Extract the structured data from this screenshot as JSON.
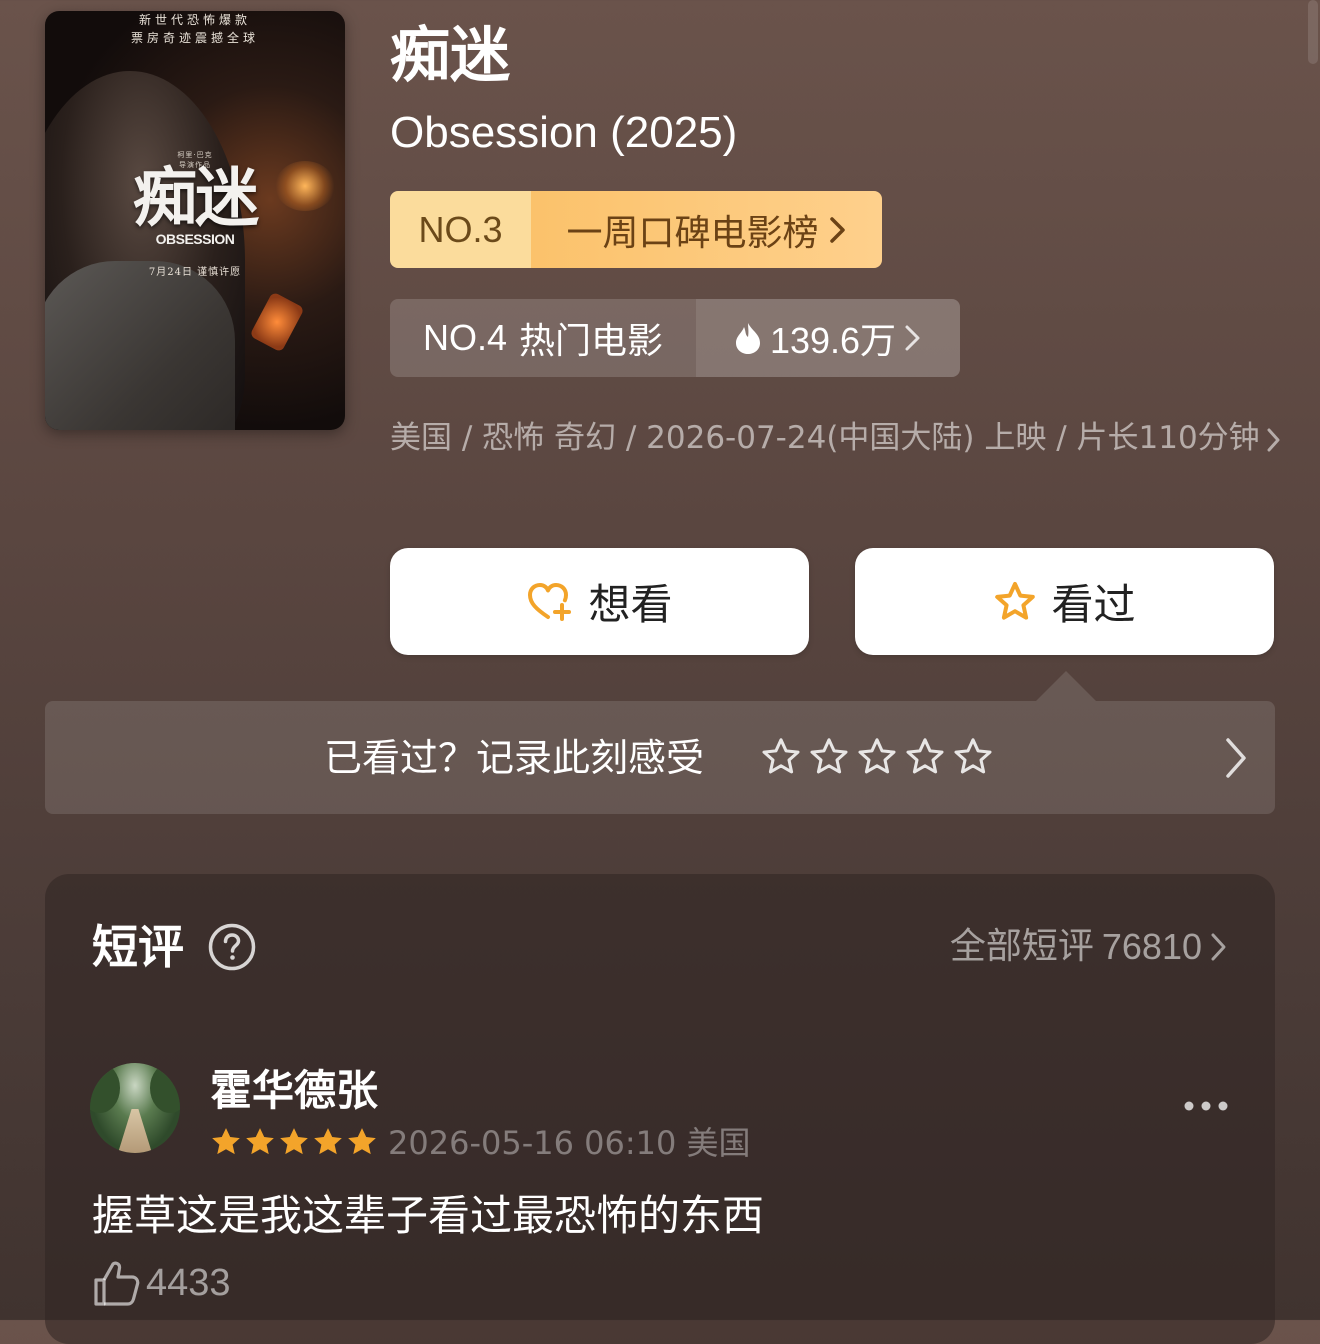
{
  "poster": {
    "tagline_line1": "新世代恐怖爆款",
    "tagline_line2": "票房奇迹震撼全球",
    "credit": "柯里·巴克",
    "credit_sub": "导演作品",
    "title_cn": "痴迷",
    "title_en": "OBSESSION",
    "date": "7月24日 谨慎许愿"
  },
  "movie": {
    "title_cn": "痴迷",
    "title_en": "Obsession (2025)",
    "meta": "美国 / 恐怖 奇幻 / 2026-07-24(中国大陆) 上映 / 片长110分钟"
  },
  "ranking_primary": {
    "rank": "NO.3",
    "list_name": "一周口碑电影榜"
  },
  "ranking_secondary": {
    "rank": "NO.4",
    "list_name": "热门电影",
    "heat": "139.6万"
  },
  "actions": {
    "want_label": "想看",
    "seen_label": "看过"
  },
  "rate_prompt": {
    "text": "已看过？记录此刻感受",
    "stars_total": 5
  },
  "short_reviews": {
    "title": "短评",
    "all_label": "全部短评",
    "total_count": "76810",
    "items": [
      {
        "user": "霍华德张",
        "rating": 5,
        "datetime": "2026-05-16 06:10",
        "location": "美国",
        "text": "握草这是我这辈子看过最恐怖的东西",
        "likes": "4433"
      }
    ]
  },
  "colors": {
    "accent_orange": "#f3a42a",
    "rank_gold_light": "#fbdc9c",
    "rank_gold": "#fbc26b",
    "background_top": "#6a534b"
  },
  "icons": {
    "want": "heart-plus-icon",
    "seen": "star-outline-icon",
    "heat": "flame-icon",
    "help": "question-circle-icon",
    "more": "more-dots-icon",
    "like": "thumbs-up-icon",
    "chevron": "chevron-right-icon"
  }
}
